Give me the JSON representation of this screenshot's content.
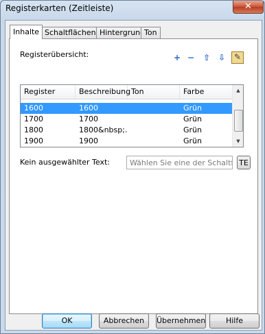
{
  "window": {
    "title": "Registerkarten (Zeitleiste)",
    "close_glyph": "✕"
  },
  "tabs": [
    {
      "label": "Inhalte"
    },
    {
      "label": "Schaltflächen"
    },
    {
      "label": "Hintergrund"
    },
    {
      "label": "Ton"
    }
  ],
  "overview": {
    "label": "Registerübersicht:",
    "tools": {
      "add": "+",
      "remove": "−",
      "up": "⇧",
      "down": "⇩",
      "edit": "✎"
    }
  },
  "list": {
    "columns": [
      "Register",
      "Beschreibung",
      "Ton",
      "Farbe"
    ],
    "rows": [
      {
        "register": "1600",
        "beschreibung": "1600",
        "ton": "",
        "farbe": "Grün"
      },
      {
        "register": "1700",
        "beschreibung": "1700",
        "ton": "",
        "farbe": "Grün"
      },
      {
        "register": "1800",
        "beschreibung": "1800&nbsp;...",
        "ton": "",
        "farbe": "Grün"
      },
      {
        "register": "1900",
        "beschreibung": "1900",
        "ton": "",
        "farbe": "Grün"
      }
    ],
    "selected_index": 0
  },
  "text_section": {
    "label": "Kein ausgewählter Text:",
    "placeholder": "Wählen Sie eine der Schaltfläche",
    "te_label": "TE"
  },
  "buttons": {
    "ok": "OK",
    "cancel": "Abbrechen",
    "apply": "Übernehmen",
    "help": "Hilfe"
  },
  "colors": {
    "selection": "#3399ff",
    "window_frame": "#c9d9eb",
    "close": "#c9553a"
  }
}
